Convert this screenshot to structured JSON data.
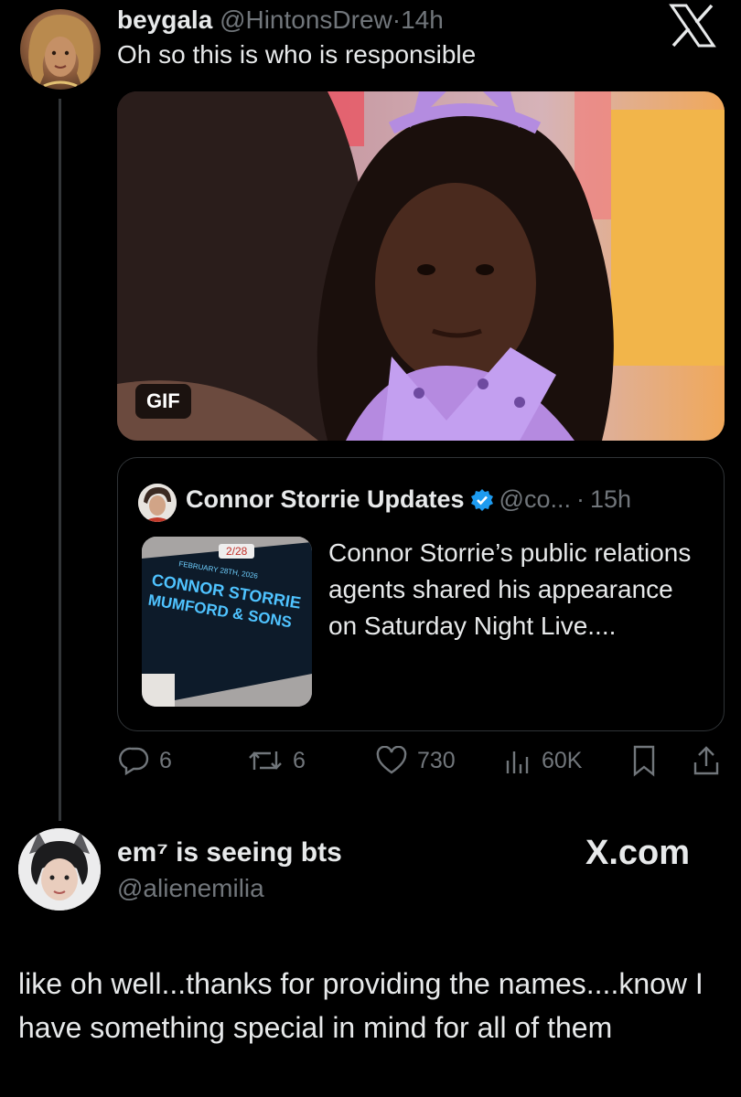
{
  "tweet": {
    "display_name": "beygala",
    "handle": "@HintonsDrew",
    "time": "14h",
    "text": "Oh so this is who is responsible",
    "gif_badge": "GIF",
    "quoted": {
      "display_name": "Connor Storrie Updates",
      "handle": "@co...",
      "time": "15h",
      "text": "Connor Storrie’s public relations agents shared his appearance on Saturday Night Live....",
      "thumb": {
        "date_chip": "2/28",
        "line1": "FEBRUARY 28TH, 2026",
        "line2": "CONNOR STORRIE",
        "line3": "MUMFORD & SONS"
      }
    },
    "actions": {
      "replies": "6",
      "reposts": "6",
      "likes": "730",
      "views": "60K"
    }
  },
  "reply": {
    "display_name": "em⁷ is seeing bts",
    "handle": "@alienemilia",
    "text": "like oh well...thanks for providing the names....know I have something special in mind for all of them"
  },
  "watermark": {
    "x_logo": "X",
    "site": "X.com"
  },
  "colors": {
    "background": "#000000",
    "text": "#e7e9ea",
    "muted": "#71767b",
    "verified": "#1d9bf0",
    "border": "#2f3336"
  }
}
